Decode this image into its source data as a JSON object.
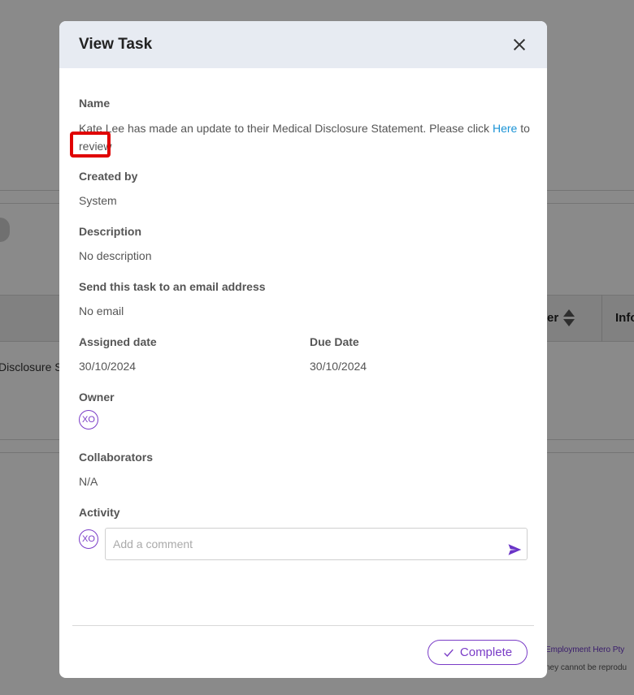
{
  "background": {
    "table_header_partial": "er",
    "table_header_partial_2": "Info",
    "row_text_partial": "Disclosure S",
    "footer_line_1": "Employment Hero Pty",
    "footer_line_2": "ney cannot be reprodu"
  },
  "modal": {
    "title": "View Task",
    "fields": {
      "name_label": "Name",
      "name_before": "Kate Lee has made an update to their Medical Disclosure Statement. Please click",
      "name_link": "Here",
      "name_after": "to review",
      "created_by_label": "Created by",
      "created_by_value": "System",
      "description_label": "Description",
      "description_value": "No description",
      "email_label": "Send this task to an email address",
      "email_value": "No email",
      "assigned_label": "Assigned date",
      "assigned_value": "30/10/2024",
      "due_label": "Due Date",
      "due_value": "30/10/2024",
      "owner_label": "Owner",
      "owner_initials": "XO",
      "collaborators_label": "Collaborators",
      "collaborators_value": "N/A",
      "activity_label": "Activity",
      "activity_initials": "XO"
    },
    "comment": {
      "placeholder": "Add a comment"
    },
    "complete_label": "Complete"
  },
  "colors": {
    "accent": "#7a3cc7",
    "link": "#1a93d6",
    "header_bg": "#e7ebf2"
  }
}
